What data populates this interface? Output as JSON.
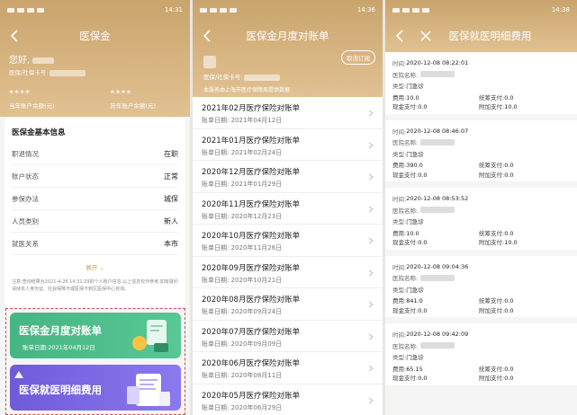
{
  "status_bar": {
    "time1": "14:31",
    "time2": "14:36",
    "time3": "14:38"
  },
  "panel1": {
    "title": "医保金",
    "greeting": "您好,",
    "card_no_label": "医保/社保卡号:",
    "current_balance_mask": "****",
    "current_balance_label": "当年账户余额(元)",
    "history_balance_mask": "****",
    "history_balance_label": "历年账户余额(元)",
    "info_heading": "医保金基本信息",
    "info_rows": [
      {
        "label": "职退情况",
        "value": "在职"
      },
      {
        "label": "账户状态",
        "value": "正常"
      },
      {
        "label": "参保办法",
        "value": "城保"
      },
      {
        "label": "人员类别",
        "value": "新人"
      },
      {
        "label": "就医关系",
        "value": "本市"
      }
    ],
    "expand_label": "展开",
    "note": "注意:查询结果为2021-4-26 14:31:29的个人账户信息,以上信息仅作参考,如有疑问请持本人身份证、社会保障卡或医保卡到区医保中心咨询。",
    "monthly_card_title": "医保金月度对账单",
    "monthly_card_date": "账单日期:2021年04月12日",
    "detail_card_title": "医保就医明细费用"
  },
  "panel2": {
    "title": "医保金月度对账单",
    "card_label": "医保/社保卡号:",
    "cancel_btn": "取消订阅",
    "org_line": "本服务由上海市医疗保障局提供数据",
    "statements": [
      {
        "title": "2021年02月医疗保险对账单",
        "date": "账单日期: 2021年04月12日"
      },
      {
        "title": "2021年01月医疗保险对账单",
        "date": "账单日期: 2021年02月24日"
      },
      {
        "title": "2020年12月医疗保险对账单",
        "date": "账单日期: 2021年01月29日"
      },
      {
        "title": "2020年11月医疗保险对账单",
        "date": "账单日期: 2020年12月23日"
      },
      {
        "title": "2020年10月医疗保险对账单",
        "date": "账单日期: 2020年11月26日"
      },
      {
        "title": "2020年09月医疗保险对账单",
        "date": "账单日期: 2020年10月21日"
      },
      {
        "title": "2020年08月医疗保险对账单",
        "date": "账单日期: 2020年09月24日"
      },
      {
        "title": "2020年07月医疗保险对账单",
        "date": "账单日期: 2020年09月09日"
      },
      {
        "title": "2020年06月医疗保险对账单",
        "date": "账单日期: 2020年08月11日"
      },
      {
        "title": "2020年05月医疗保险对账单",
        "date": "账单日期: 2020年06月29日"
      }
    ]
  },
  "panel3": {
    "title": "医保就医明细费用",
    "labels": {
      "time": "时间:",
      "hospital": "医院名称:",
      "type": "类型:",
      "fee": "费用:",
      "cash": "现金支付:",
      "pool": "统筹支付:",
      "extra": "附加支付:"
    },
    "records": [
      {
        "time": "2020-12-08 08:22:01",
        "type": "门急诊",
        "fee": "10.0",
        "cash": "0.0",
        "pool": "0.0",
        "extra": "10.0"
      },
      {
        "time": "2020-12-08 08:46:07",
        "type": "门急诊",
        "fee": "390.0",
        "cash": "0.0",
        "pool": "0.0",
        "extra": "0.0"
      },
      {
        "time": "2020-12-08 08:53:52",
        "type": "门急诊",
        "fee": "10.0",
        "cash": "0.0",
        "pool": "0.0",
        "extra": "10.0"
      },
      {
        "time": "2020-12-08 09:04:36",
        "type": "门急诊",
        "fee": "841.0",
        "cash": "0.0",
        "pool": "0.0",
        "extra": "0.0"
      },
      {
        "time": "2020-12-08 09:42:09",
        "type": "门急诊",
        "fee": "65.15",
        "cash": "0.0",
        "pool": "0.0",
        "extra": "0.0"
      }
    ]
  }
}
